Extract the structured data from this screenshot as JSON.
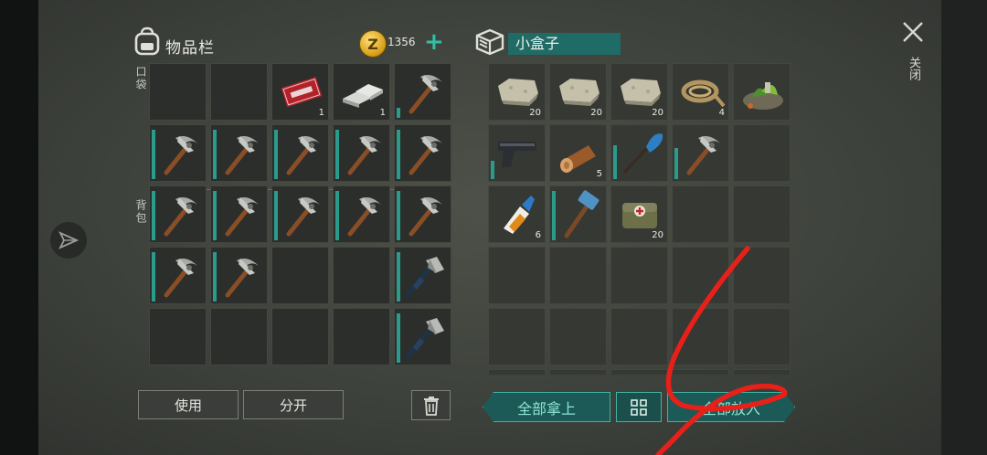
{
  "inventory": {
    "title": "物品栏",
    "coins": "1356",
    "coin_symbol": "Z",
    "pocket_label": "口袋",
    "backpack_label": "背包",
    "slots": [
      {
        "item": "empty"
      },
      {
        "item": "empty"
      },
      {
        "item": "coupon",
        "qty": "1"
      },
      {
        "item": "ingot",
        "qty": "1"
      },
      {
        "item": "pickaxe",
        "dura": 0.2
      },
      {
        "item": "pickaxe",
        "dura": 0.95
      },
      {
        "item": "pickaxe",
        "dura": 0.95
      },
      {
        "item": "pickaxe",
        "dura": 0.95
      },
      {
        "item": "pickaxe",
        "dura": 0.95
      },
      {
        "item": "pickaxe",
        "dura": 0.95
      },
      {
        "item": "pickaxe",
        "dura": 0.95
      },
      {
        "item": "pickaxe",
        "dura": 0.95
      },
      {
        "item": "pickaxe",
        "dura": 0.95
      },
      {
        "item": "pickaxe",
        "dura": 0.95
      },
      {
        "item": "pickaxe",
        "dura": 0.95
      },
      {
        "item": "pickaxe",
        "dura": 0.95
      },
      {
        "item": "pickaxe",
        "dura": 0.95
      },
      {
        "item": "empty"
      },
      {
        "item": "empty"
      },
      {
        "item": "axe",
        "dura": 0.95
      },
      {
        "item": "empty"
      },
      {
        "item": "empty"
      },
      {
        "item": "empty"
      },
      {
        "item": "empty"
      },
      {
        "item": "axe",
        "dura": 0.95
      }
    ],
    "use_button": "使用",
    "split_button": "分开"
  },
  "box": {
    "title": "小盒子",
    "slots": [
      {
        "item": "stone",
        "qty": "20"
      },
      {
        "item": "stone",
        "qty": "20"
      },
      {
        "item": "stone",
        "qty": "20"
      },
      {
        "item": "rope",
        "qty": "4"
      },
      {
        "item": "herbs"
      },
      {
        "item": "pistol",
        "dura": 0.35
      },
      {
        "item": "log",
        "qty": "5"
      },
      {
        "item": "paddle",
        "dura": 0.65
      },
      {
        "item": "pickaxe",
        "dura": 0.6
      },
      {
        "item": "empty"
      },
      {
        "item": "glue",
        "qty": "6"
      },
      {
        "item": "hammer",
        "dura": 0.95
      },
      {
        "item": "medkit",
        "qty": "20"
      },
      {
        "item": "empty"
      },
      {
        "item": "empty"
      },
      {
        "item": "empty"
      },
      {
        "item": "empty"
      },
      {
        "item": "empty"
      },
      {
        "item": "empty"
      },
      {
        "item": "empty"
      },
      {
        "item": "empty"
      },
      {
        "item": "empty"
      },
      {
        "item": "empty"
      },
      {
        "item": "empty"
      },
      {
        "item": "empty"
      },
      {
        "item": "empty"
      },
      {
        "item": "empty"
      },
      {
        "item": "empty"
      },
      {
        "item": "empty"
      },
      {
        "item": "empty"
      }
    ],
    "take_all_button": "全部拿上",
    "put_all_button": "全部放入"
  },
  "close_label": "关闭",
  "colors": {
    "accent": "#3fb3a3",
    "teal_bg": "#1b5a56",
    "annotation": "#e8201a"
  },
  "icons": [
    "backpack-icon",
    "box-icon",
    "coin-icon",
    "plus-icon",
    "trash-icon",
    "sort-icon",
    "close-icon",
    "navigation-icon"
  ]
}
